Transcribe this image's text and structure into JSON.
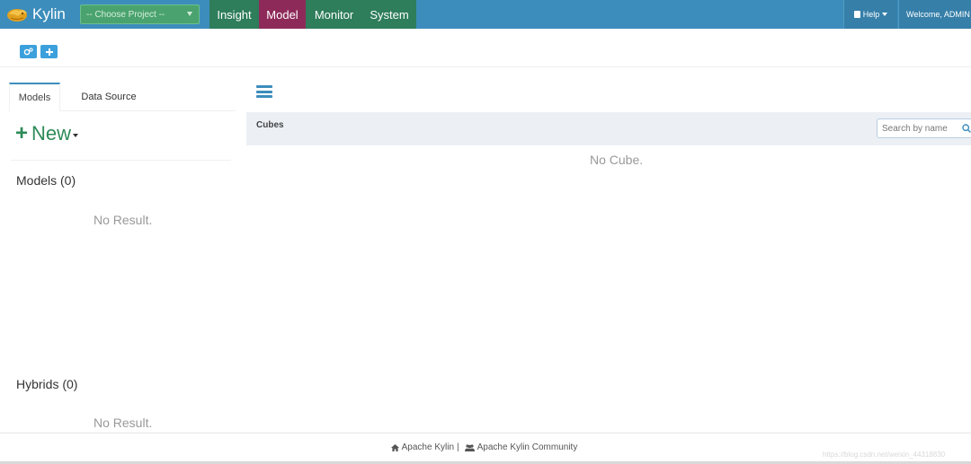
{
  "navbar": {
    "brand": "Kylin",
    "project_select": "-- Choose Project --",
    "menu": [
      {
        "label": "Insight"
      },
      {
        "label": "Model"
      },
      {
        "label": "Monitor"
      },
      {
        "label": "System"
      }
    ],
    "help_label": "Help",
    "welcome_text": "Welcome, ADMIN"
  },
  "toolbar": {
    "buttons": [
      {
        "icon": "cogs-icon"
      },
      {
        "icon": "plus-icon"
      }
    ]
  },
  "left_panel": {
    "tabs": [
      {
        "label": "Models"
      },
      {
        "label": "Data Source"
      }
    ],
    "new_button": "New",
    "models_title": "Models (0)",
    "models_empty": "No Result.",
    "hybrids_title": "Hybrids (0)",
    "hybrids_empty": "No Result."
  },
  "cubes_panel": {
    "header": "Cubes",
    "search_placeholder": "Search by name",
    "empty_text": "No Cube."
  },
  "footer": {
    "link_home": "Apache Kylin",
    "separator": "|",
    "link_community": "Apache Kylin Community",
    "watermark": "https://blog.csdn.net/weixin_44318830"
  },
  "colors": {
    "navbar_bg": "#3c8dbc",
    "nav_item_bg": "#2e7d5b",
    "nav_active_bg": "#8e2a5a",
    "new_button": "#2e8b57",
    "cubes_header_bg": "#ecf0f5"
  }
}
